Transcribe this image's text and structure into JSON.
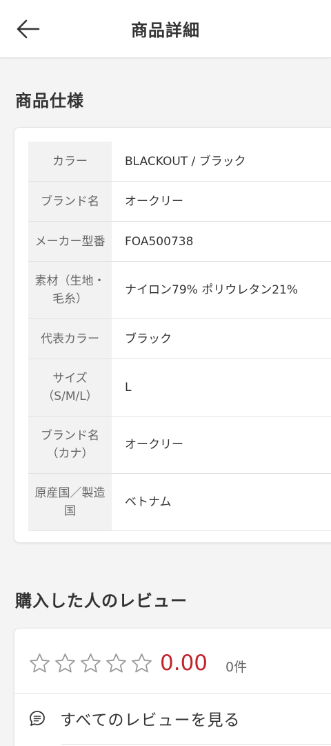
{
  "header": {
    "title": "商品詳細",
    "back_icon": "arrow-left-icon"
  },
  "spec": {
    "title": "商品仕様",
    "rows": [
      {
        "key": "カラー",
        "value": "BLACKOUT / ブラック"
      },
      {
        "key": "ブランド名",
        "value": "オークリー"
      },
      {
        "key": "メーカー型番",
        "value": "FOA500738"
      },
      {
        "key": "素材（生地・毛糸）",
        "value": "ナイロン79% ポリウレタン21%"
      },
      {
        "key": "代表カラー",
        "value": "ブラック"
      },
      {
        "key": "サイズ（S/M/L）",
        "value": "L"
      },
      {
        "key": "ブランド名（カナ）",
        "value": "オークリー"
      },
      {
        "key": "原産国／製造国",
        "value": "ベトナム"
      }
    ]
  },
  "reviews": {
    "title": "購入した人のレビュー",
    "rating": "0.00",
    "rating_fraction": 0,
    "star_count": 5,
    "count_label": "0件",
    "all_reviews_label": "すべてのレビューを見る",
    "all_reviews_icon": "comment-icon"
  },
  "colors": {
    "rating": "#c1242b",
    "text": "#333333",
    "muted": "#666666",
    "key_bg": "#f2f2f2",
    "background": "#f4f4f4"
  }
}
